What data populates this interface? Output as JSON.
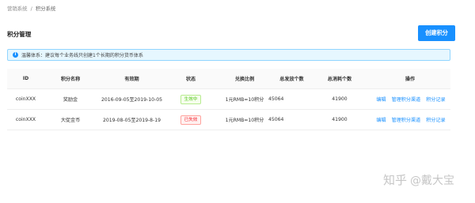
{
  "breadcrumb": {
    "items": [
      "营销系统",
      "积分系统"
    ],
    "separator": "/"
  },
  "page": {
    "title": "积分管理"
  },
  "toolbar": {
    "create_label": "创建积分"
  },
  "alert": {
    "icon": "info-icon",
    "text": "温馨体系：建议每个业务线只创建1个长期的积分货币体系"
  },
  "table": {
    "headers": {
      "id": "ID",
      "name": "积分名称",
      "valid": "有效期",
      "status": "状态",
      "ratio": "兑换比例",
      "issued": "总发放个数",
      "consumed": "总消耗个数",
      "actions": "操作"
    },
    "rows": [
      {
        "id": "coinXXX",
        "name": "奖励金",
        "valid": "2016-09-05至2019-10-05",
        "status": "生效中",
        "status_color": "#52c41a",
        "ratio": "1元RMB=10积分",
        "issued": "45064",
        "consumed": "41900",
        "actions": [
          "编辑",
          "管理积分渠道",
          "积分记录"
        ]
      },
      {
        "id": "coinXXX",
        "name": "大促金币",
        "valid": "2019-08-05至2019-8-19",
        "status": "已失效",
        "status_color": "#f5222d",
        "ratio": "1元RMB=10积分",
        "issued": "45064",
        "consumed": "41900",
        "actions": [
          "编辑",
          "管理积分渠道",
          "积分记录"
        ]
      }
    ]
  },
  "colors": {
    "primary": "#1890ff",
    "alert_bg": "#e6f7ff"
  },
  "watermark": {
    "text": "知乎",
    "author": "@戴大宝"
  }
}
